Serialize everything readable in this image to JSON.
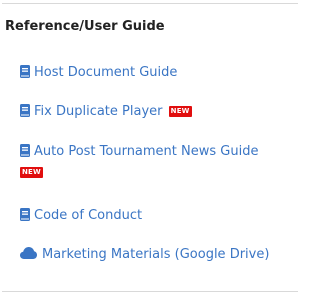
{
  "section": {
    "title": "Reference/User Guide"
  },
  "links": [
    {
      "label": "Host Document Guide",
      "icon": "book-icon"
    },
    {
      "label": "Fix Duplicate Player",
      "icon": "book-icon",
      "badge": "NEW"
    },
    {
      "label": "Auto Post Tournament News Guide",
      "icon": "book-icon",
      "badge": "NEW"
    },
    {
      "label": "Code of Conduct",
      "icon": "book-icon"
    },
    {
      "label": "Marketing Materials (Google Drive)",
      "icon": "cloud-icon"
    }
  ],
  "colors": {
    "link": "#3a75c4",
    "badge": "#e10e0e",
    "title": "#222222"
  }
}
